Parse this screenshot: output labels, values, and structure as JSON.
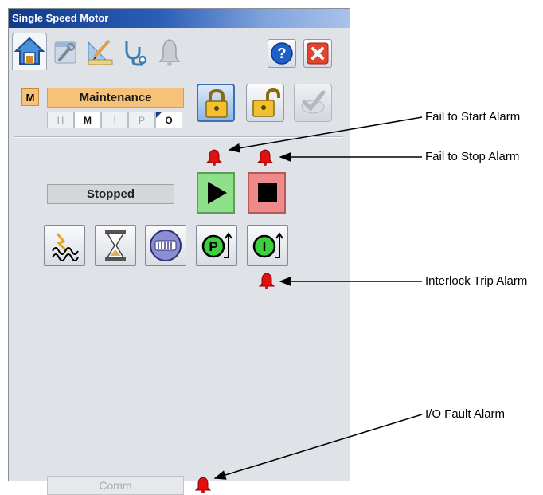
{
  "window": {
    "title": "Single Speed Motor"
  },
  "tabs": [
    {
      "name": "home",
      "icon": "home-icon"
    },
    {
      "name": "maintenance",
      "icon": "wrench-icon"
    },
    {
      "name": "engineering",
      "icon": "ruler-pencil-icon"
    },
    {
      "name": "diagnostics",
      "icon": "stethoscope-icon"
    },
    {
      "name": "alarms",
      "icon": "bell-icon"
    }
  ],
  "mode": {
    "badge": "M",
    "label": "Maintenance",
    "indicators": [
      "H",
      "M",
      "!",
      "P",
      "O"
    ]
  },
  "status": {
    "state": "Stopped",
    "comm": "Comm"
  },
  "callouts": {
    "fail_to_start": "Fail to Start Alarm",
    "fail_to_stop": "Fail to Stop Alarm",
    "interlock_trip": "Interlock Trip Alarm",
    "io_fault": "I/O Fault Alarm"
  },
  "colors": {
    "mode_bg": "#f6c27a",
    "start_green": "#8fe08a",
    "stop_red": "#f08a8a",
    "alarm_red": "#e01010",
    "title_blue": "#103a8a"
  }
}
